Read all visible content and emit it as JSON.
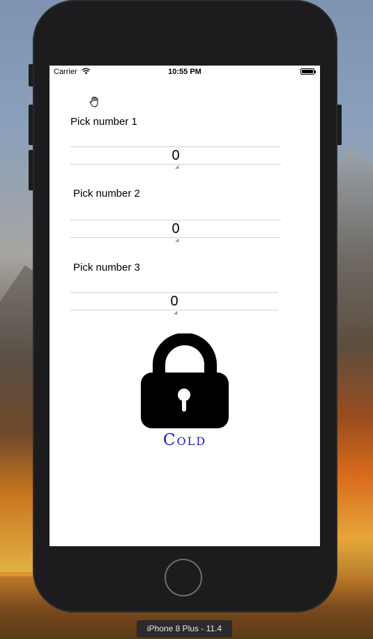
{
  "status_bar": {
    "carrier": "Carrier",
    "time": "10:55 PM"
  },
  "pickers": [
    {
      "label": "Pick number 1",
      "value": "0"
    },
    {
      "label": "Pick number 2",
      "value": "0"
    },
    {
      "label": "Pick number 3",
      "value": "0"
    }
  ],
  "lock": {
    "icon": "lock-icon",
    "status": "Cold",
    "status_color": "#1a1ad6"
  },
  "simulator": {
    "device_label": "iPhone 8 Plus - 11.4"
  }
}
